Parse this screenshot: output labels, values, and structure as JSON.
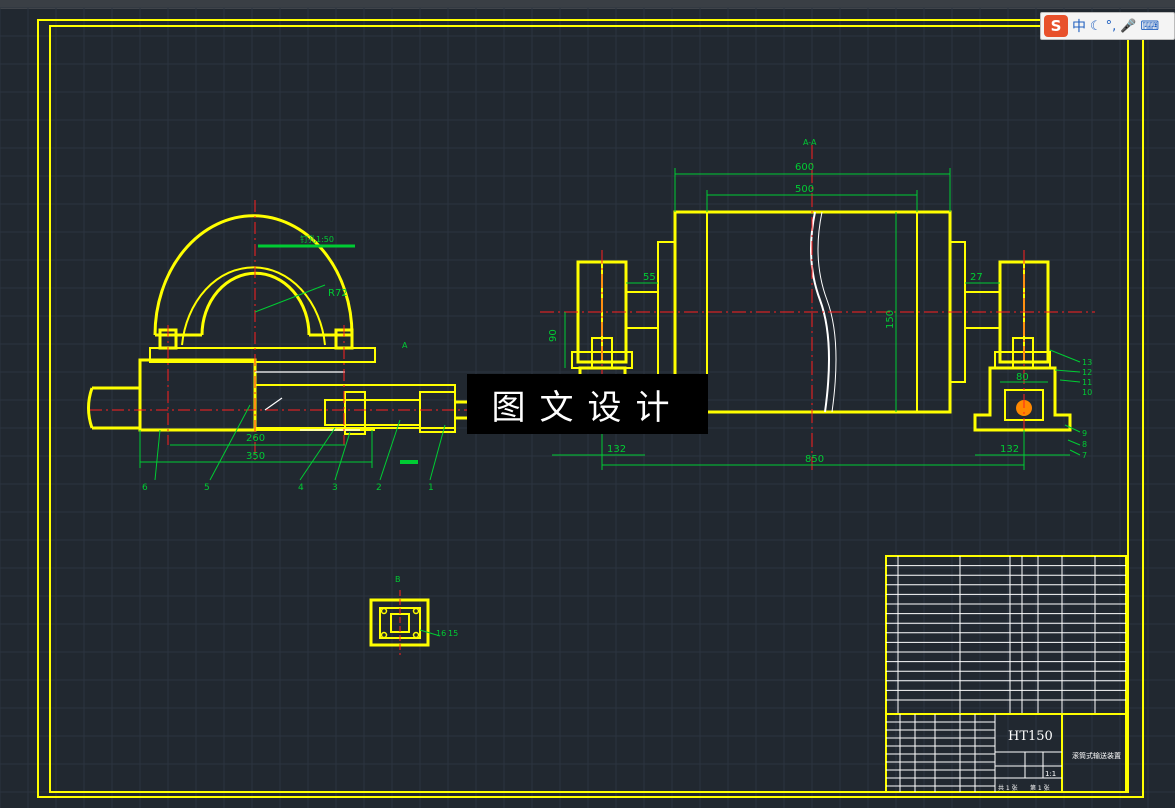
{
  "ime": {
    "logo": "S",
    "mode": "中",
    "icons": [
      "moon-icon",
      "punctuation-icon",
      "microphone-icon",
      "keyboard-icon"
    ],
    "icon_glyphs": [
      "☾",
      "°,",
      "🎤",
      "⌨"
    ]
  },
  "watermark": {
    "text": "图文设计"
  },
  "drawing": {
    "left_view": {
      "label": "R72",
      "slope_label": "钉孔1:50",
      "dims": [
        "260",
        "350"
      ],
      "part_numbers": [
        "6",
        "5",
        "4",
        "3",
        "2",
        "1"
      ],
      "section_mark": "A"
    },
    "right_view": {
      "top_mark": "A-A",
      "dims_top": [
        "600",
        "500"
      ],
      "dim_left": "55",
      "dim_right": "27",
      "dim_height": "150",
      "dim_left_height": "90",
      "dim_bottom_left": "132",
      "dim_bottom_right": "132",
      "dim_bottom_total": "850",
      "dim_block": "80",
      "callouts_right": [
        "13",
        "12",
        "11",
        "10",
        "9",
        "8",
        "7"
      ]
    },
    "detail_view": {
      "label": "B",
      "callouts": [
        "16",
        "15"
      ]
    }
  },
  "title_block": {
    "material": "HT150",
    "drawing_title": "滚筒式输送装置",
    "scale": "1:1",
    "sheet_total": "共 1 张",
    "sheet_no": "第 1 张"
  },
  "colors": {
    "background": "#212830",
    "frame": "#ffff00",
    "dimension": "#00cc33",
    "centerline": "#ff2020",
    "white_line": "#ffffff"
  }
}
